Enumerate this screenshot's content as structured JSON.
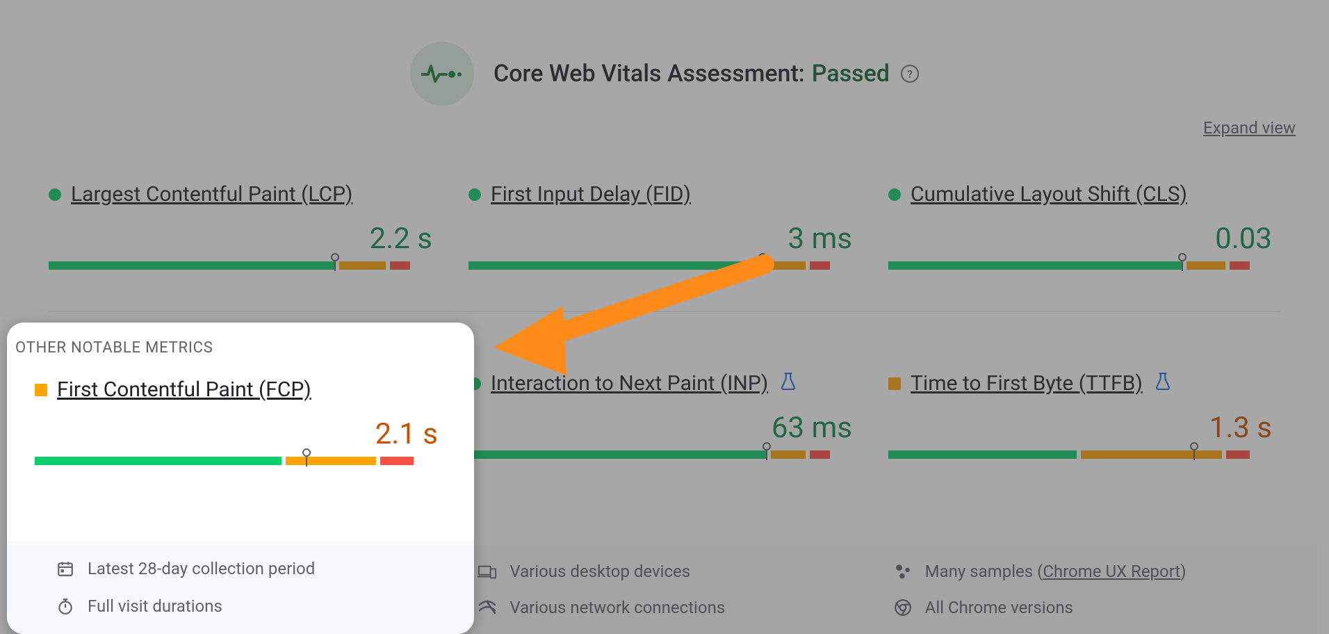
{
  "header": {
    "title_prefix": "Core Web Vitals Assessment:",
    "status": "Passed",
    "expand": "Expand view"
  },
  "core_metrics": [
    {
      "id": "lcp",
      "name": "Largest Contentful Paint (LCP)",
      "value": "2.2 s",
      "status_color": "green",
      "gauge": {
        "green": 73,
        "orange": 12,
        "red": 5,
        "marker": 73
      },
      "flask": false
    },
    {
      "id": "fid",
      "name": "First Input Delay (FID)",
      "value": "3 ms",
      "status_color": "green",
      "gauge": {
        "green": 75,
        "orange": 10,
        "red": 5,
        "marker": 75
      },
      "flask": false
    },
    {
      "id": "cls",
      "name": "Cumulative Layout Shift (CLS)",
      "value": "0.03",
      "status_color": "green",
      "gauge": {
        "green": 75,
        "orange": 10,
        "red": 5,
        "marker": 75
      },
      "flask": false
    }
  ],
  "section_label": "Other Notable Metrics",
  "other_metrics": [
    {
      "id": "fcp",
      "name": "First Contentful Paint (FCP)",
      "value": "2.1 s",
      "status_color": "orange",
      "gauge": {
        "green": 60,
        "orange": 22,
        "red": 8,
        "marker": 66
      },
      "flask": false
    },
    {
      "id": "inp",
      "name": "Interaction to Next Paint (INP)",
      "value": "63 ms",
      "status_color": "green",
      "gauge": {
        "green": 76,
        "orange": 9,
        "red": 5,
        "marker": 76
      },
      "flask": true
    },
    {
      "id": "ttfb",
      "name": "Time to First Byte (TTFB)",
      "value": "1.3 s",
      "status_color": "orange",
      "gauge": {
        "green": 48,
        "orange": 36,
        "red": 6,
        "marker": 78
      },
      "flask": true
    }
  ],
  "footer": {
    "col1": [
      {
        "icon": "calendar",
        "text": "Latest 28-day collection period"
      },
      {
        "icon": "stopwatch",
        "text": "Full visit durations"
      }
    ],
    "col2": [
      {
        "icon": "devices",
        "text": "Various desktop devices"
      },
      {
        "icon": "network",
        "text": "Various network connections"
      }
    ],
    "col3": [
      {
        "icon": "samples",
        "prefix": "Many samples (",
        "link": "Chrome UX Report",
        "suffix": ")"
      },
      {
        "icon": "chrome",
        "text": "All Chrome versions"
      }
    ]
  }
}
